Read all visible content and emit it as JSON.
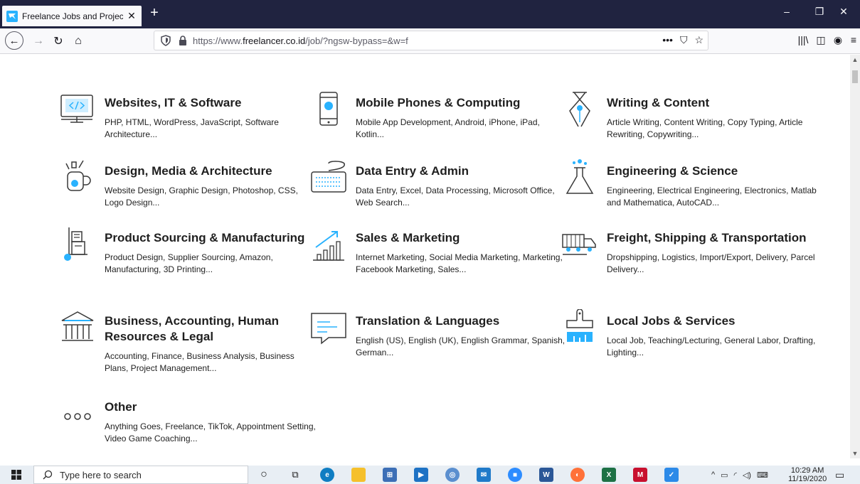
{
  "browser": {
    "tab_title": "Freelance Jobs and Projects | Freelancer",
    "url_prefix": "https://www.",
    "url_domain": "freelancer.co.id",
    "url_path": "/job/?ngsw-bypass=&w=f",
    "url_menu": "•••"
  },
  "categories": [
    {
      "title": "Websites, IT & Software",
      "desc": "PHP, HTML, WordPress, JavaScript, Software Architecture..."
    },
    {
      "title": "Mobile Phones & Computing",
      "desc": "Mobile App Development, Android, iPhone, iPad, Kotlin..."
    },
    {
      "title": "Writing & Content",
      "desc": "Article Writing, Content Writing, Copy Typing, Article Rewriting, Copywriting..."
    },
    {
      "title": "Design, Media & Architecture",
      "desc": "Website Design, Graphic Design, Photoshop, CSS, Logo Design..."
    },
    {
      "title": "Data Entry & Admin",
      "desc": "Data Entry, Excel, Data Processing, Microsoft Office, Web Search..."
    },
    {
      "title": "Engineering & Science",
      "desc": "Engineering, Electrical Engineering, Electronics, Matlab and Mathematica, AutoCAD..."
    },
    {
      "title": "Product Sourcing & Manufacturing",
      "desc": "Product Design, Supplier Sourcing, Amazon, Manufacturing, 3D Printing..."
    },
    {
      "title": "Sales & Marketing",
      "desc": "Internet Marketing, Social Media Marketing, Marketing, Facebook Marketing, Sales..."
    },
    {
      "title": "Freight, Shipping & Transportation",
      "desc": "Dropshipping, Logistics, Import/Export, Delivery, Parcel Delivery..."
    },
    {
      "title": "Business, Accounting, Human Resources & Legal",
      "desc": "Accounting, Finance, Business Analysis, Business Plans, Project Management..."
    },
    {
      "title": "Translation & Languages",
      "desc": "English (US), English (UK), English Grammar, Spanish, German..."
    },
    {
      "title": "Local Jobs & Services",
      "desc": "Local Job, Teaching/Lecturing, General Labor, Drafting, Lighting..."
    },
    {
      "title": "Other",
      "desc": "Anything Goes, Freelance, TikTok, Appointment Setting, Video Game Coaching..."
    }
  ],
  "taskbar": {
    "search_placeholder": "Type here to search",
    "time": "10:29 AM",
    "date": "11/19/2020"
  },
  "colors": {
    "tabstrip": "#202340",
    "icon_blue": "#29b2fe",
    "icon_stroke": "#3a3a3a"
  }
}
